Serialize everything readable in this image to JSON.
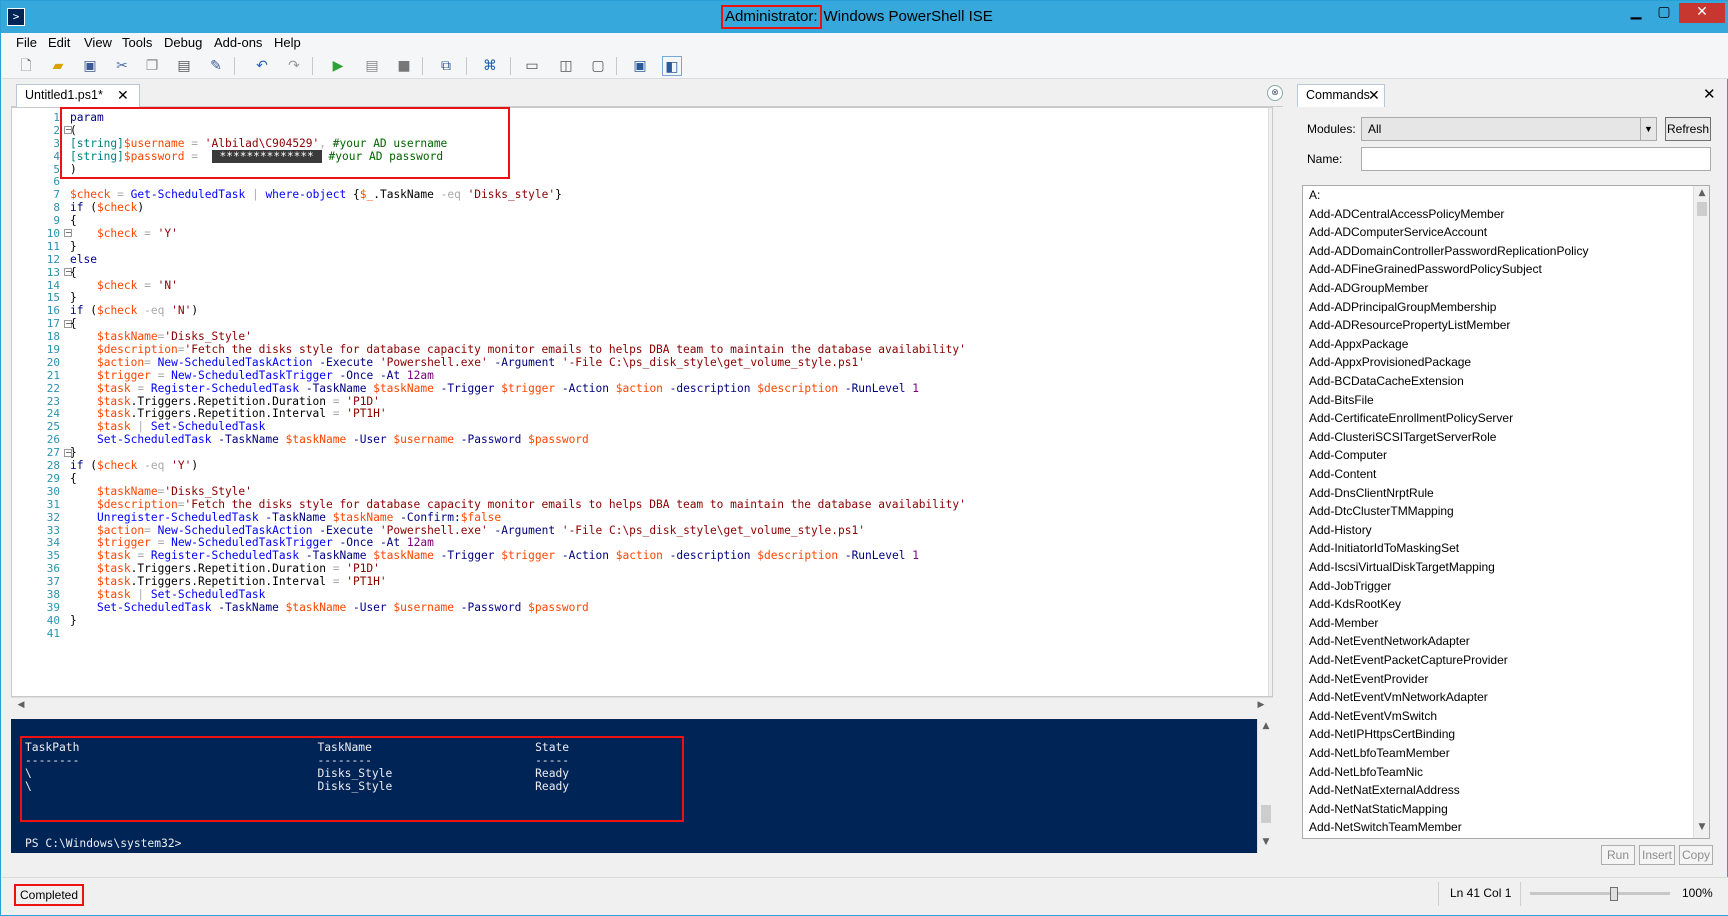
{
  "window": {
    "title_admin": "Administrator:",
    "title_app": "Windows PowerShell ISE",
    "controls": {
      "minimize": "▁",
      "maximize": "▢",
      "close": "✕"
    }
  },
  "menu": [
    "File",
    "Edit",
    "View",
    "Tools",
    "Debug",
    "Add-ons",
    "Help"
  ],
  "toolbar": {
    "icons": [
      "new-icon",
      "open-icon",
      "save-icon",
      "cut-icon",
      "copy-icon",
      "paste-icon",
      "clear-icon",
      "undo-icon",
      "redo-icon",
      "run-icon",
      "run-selection-icon",
      "stop-icon",
      "new-remote-tab-icon",
      "start-powershell-icon",
      "script-pane-top-icon",
      "script-pane-right-icon",
      "script-pane-max-icon",
      "console-icon",
      "commands-addon-icon"
    ]
  },
  "editor": {
    "tab_label": "Untitled1.ps1*",
    "tab_close": "✕",
    "collapse_glyph": "⊗",
    "line_numbers": [
      "1",
      "2",
      "3",
      "4",
      "5",
      "6",
      "7",
      "8",
      "9",
      "10",
      "11",
      "12",
      "13",
      "14",
      "15",
      "16",
      "17",
      "18",
      "19",
      "20",
      "21",
      "22",
      "23",
      "24",
      "25",
      "26",
      "27",
      "28",
      "29",
      "30",
      "31",
      "32",
      "33",
      "34",
      "35",
      "36",
      "37",
      "38",
      "39",
      "40",
      "41"
    ],
    "masked_password": "**************"
  },
  "console": {
    "lines": [
      "TaskPath                                   TaskName                        State",
      "--------                                   --------                        -----",
      "\\                                          Disks_Style                     Ready",
      "\\                                          Disks_Style                     Ready"
    ],
    "prompt": "PS C:\\Windows\\system32>"
  },
  "commands_pane": {
    "tab_label": "Commands",
    "tab_close": "✕",
    "pane_close": "✕",
    "modules_label": "Modules:",
    "modules_value": "All",
    "refresh_label": "Refresh",
    "name_label": "Name:",
    "name_value": "",
    "items": [
      "A:",
      "Add-ADCentralAccessPolicyMember",
      "Add-ADComputerServiceAccount",
      "Add-ADDomainControllerPasswordReplicationPolicy",
      "Add-ADFineGrainedPasswordPolicySubject",
      "Add-ADGroupMember",
      "Add-ADPrincipalGroupMembership",
      "Add-ADResourcePropertyListMember",
      "Add-AppxPackage",
      "Add-AppxProvisionedPackage",
      "Add-BCDataCacheExtension",
      "Add-BitsFile",
      "Add-CertificateEnrollmentPolicyServer",
      "Add-ClusteriSCSITargetServerRole",
      "Add-Computer",
      "Add-Content",
      "Add-DnsClientNrptRule",
      "Add-DtcClusterTMMapping",
      "Add-History",
      "Add-InitiatorIdToMaskingSet",
      "Add-IscsiVirtualDiskTargetMapping",
      "Add-JobTrigger",
      "Add-KdsRootKey",
      "Add-Member",
      "Add-NetEventNetworkAdapter",
      "Add-NetEventPacketCaptureProvider",
      "Add-NetEventProvider",
      "Add-NetEventVmNetworkAdapter",
      "Add-NetEventVmSwitch",
      "Add-NetIPHttpsCertBinding",
      "Add-NetLbfoTeamMember",
      "Add-NetLbfoTeamNic",
      "Add-NetNatExternalAddress",
      "Add-NetNatStaticMapping",
      "Add-NetSwitchTeamMember"
    ],
    "buttons": {
      "run": "Run",
      "insert": "Insert",
      "copy": "Copy"
    }
  },
  "status": {
    "text": "Completed",
    "position": "Ln 41  Col 1",
    "zoom": "100%",
    "zoom_level": 0.6
  },
  "colors": {
    "title_bar": "#36a8db",
    "console_bg": "#012456",
    "highlight_box": "#ee1111",
    "keyword": "#00008b",
    "variable": "#ff4500",
    "cmdlet": "#0000ff",
    "string": "#8b0000",
    "comment": "#006400"
  }
}
